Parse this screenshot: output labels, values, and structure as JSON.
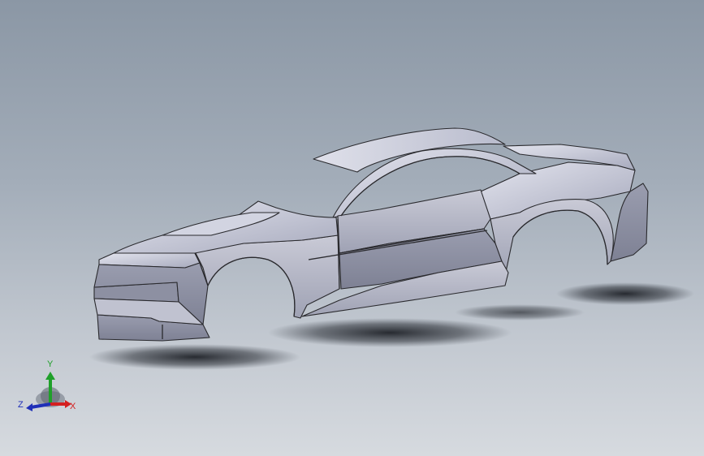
{
  "triad": {
    "x_label": "X",
    "y_label": "Y",
    "z_label": "Z",
    "x_color": "#d42020",
    "y_color": "#1fa02a",
    "z_color": "#1f2fb8"
  },
  "model": {
    "body_color": "#b6b9c9",
    "shadow_color": "#2a2e35",
    "edge_color": "#2a2a2e"
  }
}
